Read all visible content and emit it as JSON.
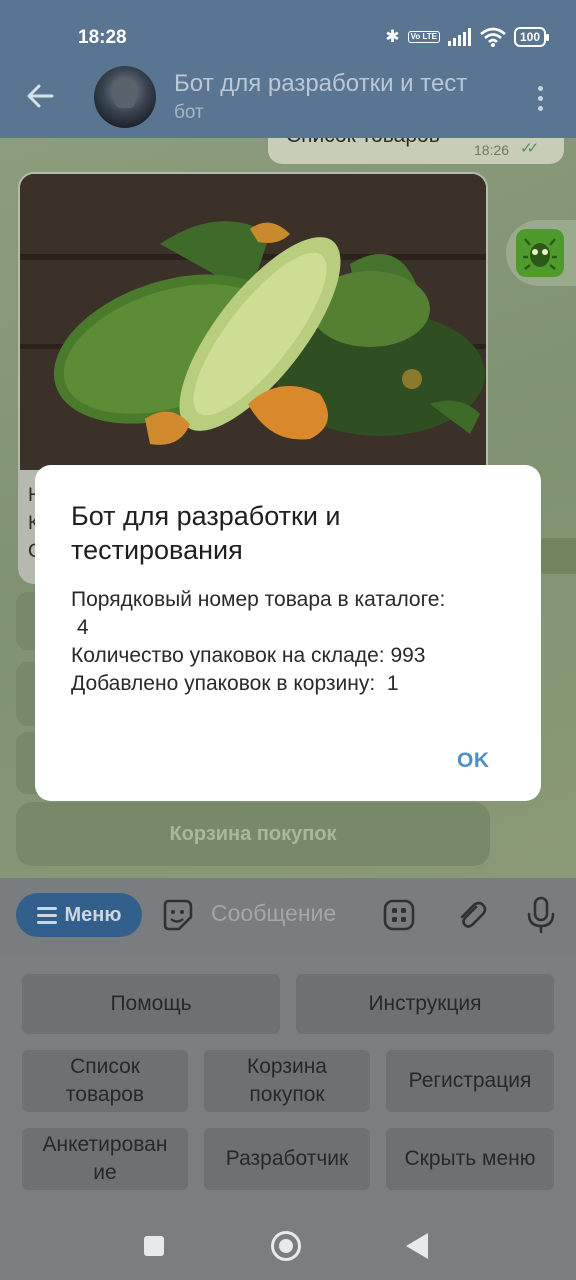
{
  "status_bar": {
    "time": "18:28",
    "battery": "100",
    "network_badge": "Vo LTE"
  },
  "header": {
    "title": "Бот для разработки и тест",
    "subtitle": "бот"
  },
  "chat": {
    "outgoing_message": {
      "text": "Список товаров",
      "time": "18:26"
    },
    "photo_caption_stub": "Н\nК\nС",
    "inline_button_visible": "Корзина покупок"
  },
  "input_bar": {
    "menu_label": "Меню",
    "placeholder": "Сообщение"
  },
  "keyboard": {
    "rows": [
      [
        "Помощь",
        "Инструкция"
      ],
      [
        "Список\nтоваров",
        "Корзина\nпокупок",
        "Регистрация"
      ],
      [
        "Анкетирован\nие",
        "Разработчик",
        "Скрыть меню"
      ]
    ]
  },
  "dialog": {
    "title": "Бот для разработки и тестирования",
    "body": "Порядковый номер товара в каталоге:\n 4\nКоличество упаковок на складе: 993\nДобавлено упаковок в корзину:  1",
    "ok_label": "OK"
  },
  "colors": {
    "header": "#5a7591",
    "accent": "#4c8fc9",
    "menu_button": "#335f8c"
  }
}
